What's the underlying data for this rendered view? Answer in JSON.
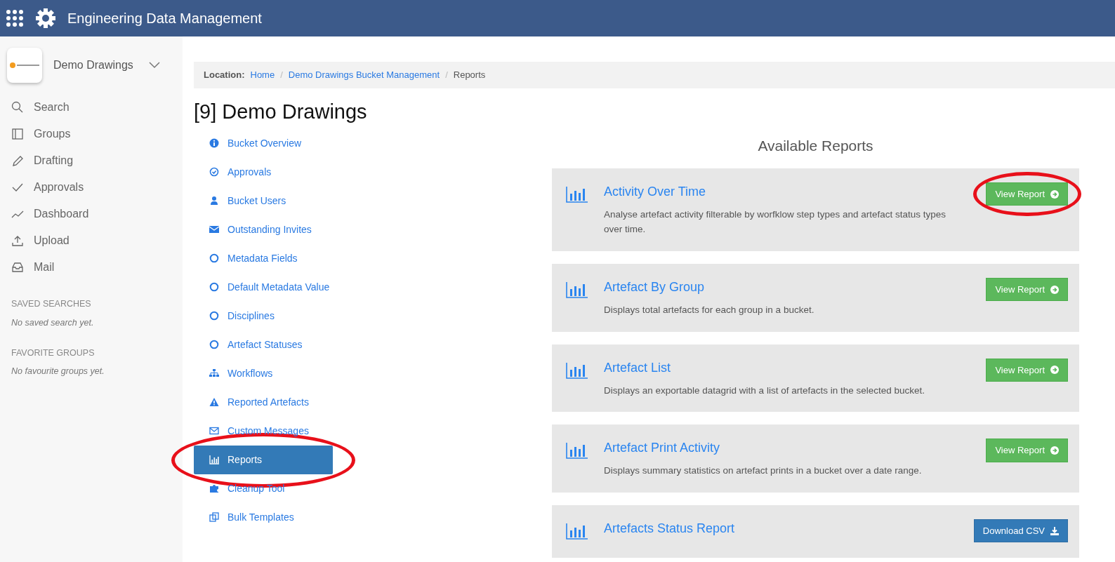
{
  "app": {
    "title": "Engineering Data Management"
  },
  "bucket_switcher": {
    "name": "Demo Drawings"
  },
  "sidebar": {
    "items": [
      {
        "label": "Search"
      },
      {
        "label": "Groups"
      },
      {
        "label": "Drafting"
      },
      {
        "label": "Approvals"
      },
      {
        "label": "Dashboard"
      },
      {
        "label": "Upload"
      },
      {
        "label": "Mail"
      }
    ],
    "sections": [
      {
        "heading": "SAVED SEARCHES",
        "empty_text": "No saved search yet."
      },
      {
        "heading": "FAVORITE GROUPS",
        "empty_text": "No favourite groups yet."
      }
    ]
  },
  "breadcrumb": {
    "label": "Location:",
    "separator": "/",
    "items": [
      {
        "label": "Home",
        "link": true
      },
      {
        "label": "Demo Drawings Bucket Management",
        "link": true
      },
      {
        "label": "Reports",
        "link": false
      }
    ]
  },
  "page_title": "[9] Demo Drawings",
  "bucket_nav": [
    {
      "label": "Bucket Overview",
      "selected": false,
      "circled": false
    },
    {
      "label": "Approvals",
      "selected": false,
      "circled": false
    },
    {
      "label": "Bucket Users",
      "selected": false,
      "circled": false
    },
    {
      "label": "Outstanding Invites",
      "selected": false,
      "circled": false
    },
    {
      "label": "Metadata Fields",
      "selected": false,
      "circled": false
    },
    {
      "label": "Default Metadata Value",
      "selected": false,
      "circled": false
    },
    {
      "label": "Disciplines",
      "selected": false,
      "circled": false
    },
    {
      "label": "Artefact Statuses",
      "selected": false,
      "circled": false
    },
    {
      "label": "Workflows",
      "selected": false,
      "circled": false
    },
    {
      "label": "Reported Artefacts",
      "selected": false,
      "circled": false
    },
    {
      "label": "Custom Messages",
      "selected": false,
      "circled": false
    },
    {
      "label": "Reports",
      "selected": true,
      "circled": true
    },
    {
      "label": "Cleanup Tool",
      "selected": false,
      "circled": false
    },
    {
      "label": "Bulk Templates",
      "selected": false,
      "circled": false
    }
  ],
  "reports": {
    "heading": "Available Reports",
    "items": [
      {
        "title": "Activity Over Time",
        "description": "Analyse artefact activity filterable by worfklow step types and artefact status types over time.",
        "button": "View Report",
        "kind": "view",
        "circled": true
      },
      {
        "title": "Artefact By Group",
        "description": "Displays total artefacts for each group in a bucket.",
        "button": "View Report",
        "kind": "view",
        "circled": false
      },
      {
        "title": "Artefact List",
        "description": "Displays an exportable datagrid with a list of artefacts in the selected bucket.",
        "button": "View Report",
        "kind": "view",
        "circled": false
      },
      {
        "title": "Artefact Print Activity",
        "description": "Displays summary statistics on artefact prints in a bucket over a date range.",
        "button": "View Report",
        "kind": "view",
        "circled": false
      },
      {
        "title": "Artefacts Status Report",
        "button": "Download CSV",
        "kind": "download",
        "circled": false
      }
    ]
  }
}
